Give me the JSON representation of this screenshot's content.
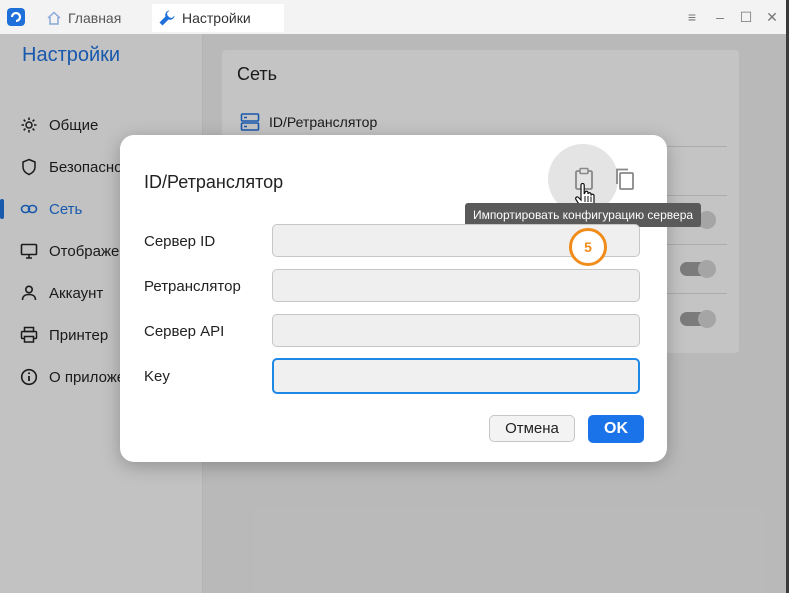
{
  "titlebar": {
    "tabs": [
      {
        "label": "Главная",
        "icon": "home-icon"
      },
      {
        "label": "Настройки",
        "icon": "wrench-icon"
      }
    ],
    "window_controls": [
      "menu-icon",
      "minimize-icon",
      "maximize-icon",
      "close-icon"
    ]
  },
  "sidebar": {
    "title": "Настройки",
    "items": [
      {
        "label": "Общие",
        "icon": "gear-icon"
      },
      {
        "label": "Безопасность",
        "icon": "shield-icon"
      },
      {
        "label": "Сеть",
        "icon": "link-icon",
        "active": true
      },
      {
        "label": "Отображение",
        "icon": "monitor-icon"
      },
      {
        "label": "Аккаунт",
        "icon": "user-icon"
      },
      {
        "label": "Принтер",
        "icon": "printer-icon"
      },
      {
        "label": "О приложении",
        "icon": "info-icon"
      }
    ]
  },
  "main": {
    "card_title": "Сеть",
    "rows": [
      {
        "label": "ID/Ретранслятор",
        "icon": "server-icon"
      }
    ]
  },
  "dialog": {
    "title": "ID/Ретранслятор",
    "tooltip": "Импортировать конфигурацию сервера",
    "fields": [
      {
        "label": "Сервер ID",
        "value": ""
      },
      {
        "label": "Ретранслятор",
        "value": ""
      },
      {
        "label": "Сервер API",
        "value": ""
      },
      {
        "label": "Key",
        "value": ""
      }
    ],
    "cancel_label": "Отмена",
    "ok_label": "OK",
    "step_badge": "5"
  },
  "colors": {
    "accent": "#1e6fd9",
    "ok_button": "#1a73e8",
    "step_badge": "#f08c1a"
  }
}
